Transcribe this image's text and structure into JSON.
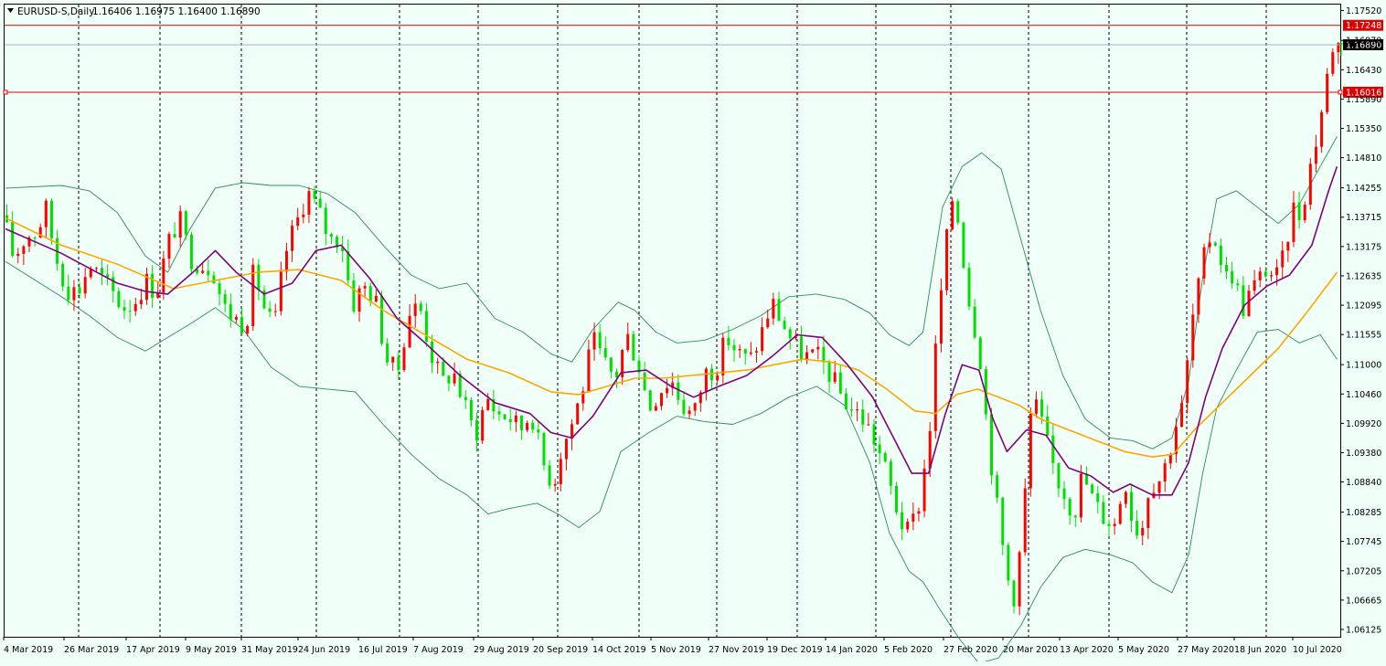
{
  "header": {
    "symbol": "EURUSD-S,Daily",
    "ohlc": "1.16406 1.16975 1.16400 1.16890"
  },
  "price_tags": {
    "resistance": "1.17248",
    "current": "1.16890",
    "support": "1.16016"
  },
  "colors": {
    "background": "#f0fff8",
    "bull": "#ff0000",
    "bear": "#00e000",
    "ma_fast": "#800080",
    "ma_slow": "#ffa500",
    "bollinger": "#2e8b57",
    "hline": "#e00000",
    "bidline": "#9fb9c4"
  },
  "chart_data": {
    "type": "candlestick",
    "title": "EURUSD-S,Daily",
    "y_ticks": [
      "1.17520",
      "1.16970",
      "1.16430",
      "1.15890",
      "1.15350",
      "1.14810",
      "1.14255",
      "1.13715",
      "1.13175",
      "1.12635",
      "1.12095",
      "1.11555",
      "1.11000",
      "1.10460",
      "1.09920",
      "1.09380",
      "1.08840",
      "1.08285",
      "1.07745",
      "1.07205",
      "1.06665",
      "1.06125"
    ],
    "ylim": [
      1.0599,
      1.1763
    ],
    "x_labels": [
      "4 Mar 2019",
      "26 Mar 2019",
      "17 Apr 2019",
      "9 May 2019",
      "31 May 2019",
      "24 Jun 2019",
      "16 Jul 2019",
      "7 Aug 2019",
      "29 Aug 2019",
      "20 Sep 2019",
      "14 Oct 2019",
      "5 Nov 2019",
      "27 Nov 2019",
      "19 Dec 2019",
      "14 Jan 2020",
      "5 Feb 2020",
      "27 Feb 2020",
      "20 Mar 2020",
      "13 Apr 2020",
      "5 May 2020",
      "27 May 2020",
      "18 Jun 2020",
      "10 Jul 2020"
    ],
    "horizontal_lines": [
      1.17248,
      1.16016
    ],
    "current_price": 1.1689,
    "price_path": [
      [
        0,
        1.1375
      ],
      [
        8,
        1.1295
      ],
      [
        16,
        1.1335
      ],
      [
        24,
        1.1345
      ],
      [
        31,
        1.1385
      ],
      [
        38,
        1.13
      ],
      [
        46,
        1.124
      ],
      [
        54,
        1.1235
      ],
      [
        62,
        1.1285
      ],
      [
        70,
        1.126
      ],
      [
        78,
        1.1235
      ],
      [
        86,
        1.1205
      ],
      [
        94,
        1.1215
      ],
      [
        102,
        1.1255
      ],
      [
        110,
        1.1235
      ],
      [
        118,
        1.132
      ],
      [
        126,
        1.137
      ],
      [
        134,
        1.13
      ],
      [
        142,
        1.1285
      ],
      [
        150,
        1.128
      ],
      [
        158,
        1.1205
      ],
      [
        166,
        1.1185
      ],
      [
        174,
        1.1175
      ],
      [
        180,
        1.128
      ],
      [
        186,
        1.121
      ],
      [
        194,
        1.1165
      ],
      [
        202,
        1.1305
      ],
      [
        210,
        1.136
      ],
      [
        218,
        1.142
      ],
      [
        226,
        1.138
      ],
      [
        234,
        1.133
      ],
      [
        242,
        1.1335
      ],
      [
        250,
        1.121
      ],
      [
        258,
        1.1245
      ],
      [
        266,
        1.1225
      ],
      [
        274,
        1.1115
      ],
      [
        282,
        1.108
      ],
      [
        290,
        1.1195
      ],
      [
        298,
        1.121
      ],
      [
        306,
        1.1125
      ],
      [
        314,
        1.1065
      ],
      [
        322,
        1.109
      ],
      [
        330,
        1.1025
      ],
      [
        338,
        1.097
      ],
      [
        346,
        1.104
      ],
      [
        354,
        1.101
      ],
      [
        362,
        1.1005
      ],
      [
        370,
        1.098
      ],
      [
        378,
        1.1015
      ],
      [
        386,
        1.092
      ],
      [
        394,
        1.088
      ],
      [
        398,
        1.0935
      ],
      [
        406,
        1.0985
      ],
      [
        414,
        1.105
      ],
      [
        422,
        1.1145
      ],
      [
        430,
        1.11
      ],
      [
        438,
        1.1075
      ],
      [
        446,
        1.1155
      ],
      [
        454,
        1.111
      ],
      [
        462,
        1.102
      ],
      [
        470,
        1.1055
      ],
      [
        478,
        1.1075
      ],
      [
        486,
        1.1025
      ],
      [
        494,
        1.1005
      ],
      [
        502,
        1.1085
      ],
      [
        510,
        1.1095
      ],
      [
        518,
        1.115
      ],
      [
        526,
        1.112
      ],
      [
        534,
        1.1105
      ],
      [
        542,
        1.1155
      ],
      [
        550,
        1.1215
      ],
      [
        558,
        1.1175
      ],
      [
        566,
        1.1135
      ],
      [
        574,
        1.1115
      ],
      [
        582,
        1.1115
      ],
      [
        590,
        1.109
      ],
      [
        598,
        1.105
      ],
      [
        606,
        1.102
      ],
      [
        614,
        1.1005
      ],
      [
        622,
        1.097
      ],
      [
        630,
        1.0915
      ],
      [
        638,
        1.0845
      ],
      [
        646,
        1.0785
      ],
      [
        654,
        1.083
      ],
      [
        662,
        1.0955
      ],
      [
        668,
        1.116
      ],
      [
        674,
        1.131
      ],
      [
        680,
        1.1425
      ],
      [
        686,
        1.1315
      ],
      [
        692,
        1.12
      ],
      [
        698,
        1.114
      ],
      [
        704,
        1.098
      ],
      [
        710,
        1.0855
      ],
      [
        718,
        1.071
      ],
      [
        724,
        1.067
      ],
      [
        730,
        1.083
      ],
      [
        736,
        1.104
      ],
      [
        742,
        1.1
      ],
      [
        748,
        1.094
      ],
      [
        754,
        1.089
      ],
      [
        760,
        1.086
      ],
      [
        766,
        1.0825
      ],
      [
        772,
        1.09
      ],
      [
        778,
        1.086
      ],
      [
        784,
        1.083
      ],
      [
        790,
        1.0815
      ],
      [
        796,
        1.0805
      ],
      [
        802,
        1.09
      ],
      [
        808,
        1.081
      ],
      [
        814,
        1.079
      ],
      [
        820,
        1.0885
      ],
      [
        826,
        1.0885
      ],
      [
        832,
        1.092
      ],
      [
        838,
        1.0985
      ],
      [
        844,
        1.1025
      ],
      [
        850,
        1.1175
      ],
      [
        856,
        1.1255
      ],
      [
        862,
        1.1335
      ],
      [
        868,
        1.133
      ],
      [
        874,
        1.126
      ],
      [
        880,
        1.127
      ],
      [
        886,
        1.12
      ],
      [
        892,
        1.1235
      ],
      [
        898,
        1.1255
      ],
      [
        904,
        1.128
      ],
      [
        910,
        1.1255
      ],
      [
        916,
        1.1295
      ],
      [
        922,
        1.139
      ],
      [
        928,
        1.1375
      ],
      [
        934,
        1.1455
      ],
      [
        940,
        1.1525
      ],
      [
        946,
        1.161
      ],
      [
        950,
        1.1689
      ]
    ],
    "ma_fast_path": [
      [
        0,
        1.135
      ],
      [
        40,
        1.1305
      ],
      [
        80,
        1.125
      ],
      [
        100,
        1.1235
      ],
      [
        116,
        1.123
      ],
      [
        134,
        1.127
      ],
      [
        150,
        1.131
      ],
      [
        165,
        1.127
      ],
      [
        185,
        1.123
      ],
      [
        205,
        1.125
      ],
      [
        222,
        1.131
      ],
      [
        240,
        1.132
      ],
      [
        260,
        1.126
      ],
      [
        280,
        1.1185
      ],
      [
        300,
        1.114
      ],
      [
        325,
        1.108
      ],
      [
        350,
        1.103
      ],
      [
        375,
        1.101
      ],
      [
        390,
        1.0975
      ],
      [
        405,
        1.0965
      ],
      [
        420,
        1.1005
      ],
      [
        440,
        1.1085
      ],
      [
        458,
        1.109
      ],
      [
        476,
        1.106
      ],
      [
        492,
        1.104
      ],
      [
        510,
        1.106
      ],
      [
        530,
        1.108
      ],
      [
        548,
        1.1115
      ],
      [
        566,
        1.1155
      ],
      [
        584,
        1.115
      ],
      [
        602,
        1.11
      ],
      [
        620,
        1.104
      ],
      [
        636,
        1.096
      ],
      [
        648,
        1.09
      ],
      [
        660,
        1.09
      ],
      [
        672,
        1.101
      ],
      [
        684,
        1.11
      ],
      [
        696,
        1.109
      ],
      [
        706,
        1.1
      ],
      [
        716,
        1.094
      ],
      [
        730,
        1.098
      ],
      [
        744,
        1.097
      ],
      [
        760,
        1.091
      ],
      [
        776,
        1.0895
      ],
      [
        792,
        1.0865
      ],
      [
        804,
        1.088
      ],
      [
        820,
        1.086
      ],
      [
        834,
        1.086
      ],
      [
        846,
        1.092
      ],
      [
        858,
        1.104
      ],
      [
        870,
        1.113
      ],
      [
        886,
        1.121
      ],
      [
        902,
        1.1245
      ],
      [
        918,
        1.1265
      ],
      [
        934,
        1.132
      ],
      [
        946,
        1.142
      ],
      [
        952,
        1.1465
      ]
    ],
    "ma_slow_path": [
      [
        0,
        1.137
      ],
      [
        40,
        1.132
      ],
      [
        80,
        1.1285
      ],
      [
        120,
        1.124
      ],
      [
        150,
        1.1255
      ],
      [
        180,
        1.127
      ],
      [
        210,
        1.1275
      ],
      [
        240,
        1.1255
      ],
      [
        270,
        1.12
      ],
      [
        300,
        1.1155
      ],
      [
        330,
        1.111
      ],
      [
        360,
        1.1085
      ],
      [
        390,
        1.105
      ],
      [
        410,
        1.1045
      ],
      [
        430,
        1.106
      ],
      [
        450,
        1.1075
      ],
      [
        470,
        1.1075
      ],
      [
        490,
        1.108
      ],
      [
        510,
        1.1085
      ],
      [
        530,
        1.109
      ],
      [
        550,
        1.11
      ],
      [
        570,
        1.111
      ],
      [
        590,
        1.1105
      ],
      [
        610,
        1.109
      ],
      [
        630,
        1.1055
      ],
      [
        650,
        1.1015
      ],
      [
        665,
        1.101
      ],
      [
        680,
        1.1045
      ],
      [
        695,
        1.1055
      ],
      [
        710,
        1.104
      ],
      [
        725,
        1.1025
      ],
      [
        740,
        1.1
      ],
      [
        760,
        1.098
      ],
      [
        780,
        1.096
      ],
      [
        800,
        1.094
      ],
      [
        820,
        1.093
      ],
      [
        835,
        1.0935
      ],
      [
        850,
        1.098
      ],
      [
        870,
        1.103
      ],
      [
        890,
        1.108
      ],
      [
        910,
        1.113
      ],
      [
        930,
        1.1195
      ],
      [
        952,
        1.127
      ]
    ],
    "bb_upper_path": [
      [
        0,
        1.1425
      ],
      [
        40,
        1.143
      ],
      [
        60,
        1.142
      ],
      [
        80,
        1.138
      ],
      [
        100,
        1.13
      ],
      [
        116,
        1.127
      ],
      [
        132,
        1.135
      ],
      [
        150,
        1.1425
      ],
      [
        170,
        1.1435
      ],
      [
        190,
        1.143
      ],
      [
        210,
        1.143
      ],
      [
        230,
        1.1415
      ],
      [
        250,
        1.138
      ],
      [
        270,
        1.132
      ],
      [
        290,
        1.1265
      ],
      [
        310,
        1.124
      ],
      [
        330,
        1.125
      ],
      [
        350,
        1.1185
      ],
      [
        370,
        1.116
      ],
      [
        390,
        1.112
      ],
      [
        405,
        1.1105
      ],
      [
        420,
        1.1165
      ],
      [
        438,
        1.1215
      ],
      [
        450,
        1.12
      ],
      [
        465,
        1.116
      ],
      [
        480,
        1.114
      ],
      [
        500,
        1.1145
      ],
      [
        520,
        1.1165
      ],
      [
        540,
        1.119
      ],
      [
        560,
        1.1225
      ],
      [
        580,
        1.123
      ],
      [
        600,
        1.122
      ],
      [
        618,
        1.1195
      ],
      [
        632,
        1.1155
      ],
      [
        646,
        1.1135
      ],
      [
        656,
        1.116
      ],
      [
        670,
        1.139
      ],
      [
        684,
        1.1465
      ],
      [
        698,
        1.149
      ],
      [
        712,
        1.146
      ],
      [
        726,
        1.133
      ],
      [
        740,
        1.12
      ],
      [
        756,
        1.108
      ],
      [
        772,
        1.1
      ],
      [
        790,
        1.0965
      ],
      [
        806,
        1.096
      ],
      [
        820,
        1.0945
      ],
      [
        834,
        1.0965
      ],
      [
        846,
        1.107
      ],
      [
        856,
        1.126
      ],
      [
        866,
        1.1405
      ],
      [
        880,
        1.142
      ],
      [
        895,
        1.139
      ],
      [
        910,
        1.136
      ],
      [
        925,
        1.1395
      ],
      [
        940,
        1.1465
      ],
      [
        952,
        1.152
      ]
    ],
    "bb_lower_path": [
      [
        0,
        1.129
      ],
      [
        40,
        1.1225
      ],
      [
        60,
        1.119
      ],
      [
        80,
        1.115
      ],
      [
        100,
        1.1125
      ],
      [
        116,
        1.115
      ],
      [
        132,
        1.1175
      ],
      [
        150,
        1.1205
      ],
      [
        170,
        1.1165
      ],
      [
        190,
        1.1095
      ],
      [
        210,
        1.106
      ],
      [
        230,
        1.1055
      ],
      [
        250,
        1.105
      ],
      [
        270,
        1.099
      ],
      [
        290,
        1.0935
      ],
      [
        310,
        1.089
      ],
      [
        330,
        1.086
      ],
      [
        345,
        1.0825
      ],
      [
        360,
        1.0835
      ],
      [
        380,
        1.0845
      ],
      [
        395,
        1.0825
      ],
      [
        410,
        1.08
      ],
      [
        425,
        1.083
      ],
      [
        440,
        1.094
      ],
      [
        460,
        1.0975
      ],
      [
        480,
        1.1005
      ],
      [
        500,
        1.0995
      ],
      [
        520,
        1.099
      ],
      [
        540,
        1.101
      ],
      [
        560,
        1.104
      ],
      [
        580,
        1.106
      ],
      [
        600,
        1.1025
      ],
      [
        618,
        1.092
      ],
      [
        632,
        1.079
      ],
      [
        646,
        1.072
      ],
      [
        656,
        1.07
      ],
      [
        668,
        1.065
      ],
      [
        682,
        1.0595
      ],
      [
        696,
        1.055
      ],
      [
        710,
        1.056
      ],
      [
        726,
        1.062
      ],
      [
        740,
        1.069
      ],
      [
        756,
        1.0745
      ],
      [
        772,
        1.076
      ],
      [
        790,
        1.075
      ],
      [
        806,
        1.0735
      ],
      [
        820,
        1.07
      ],
      [
        834,
        1.068
      ],
      [
        846,
        1.075
      ],
      [
        856,
        1.09
      ],
      [
        866,
        1.102
      ],
      [
        880,
        1.109
      ],
      [
        895,
        1.116
      ],
      [
        910,
        1.1165
      ],
      [
        925,
        1.114
      ],
      [
        940,
        1.1155
      ],
      [
        952,
        1.111
      ]
    ]
  }
}
